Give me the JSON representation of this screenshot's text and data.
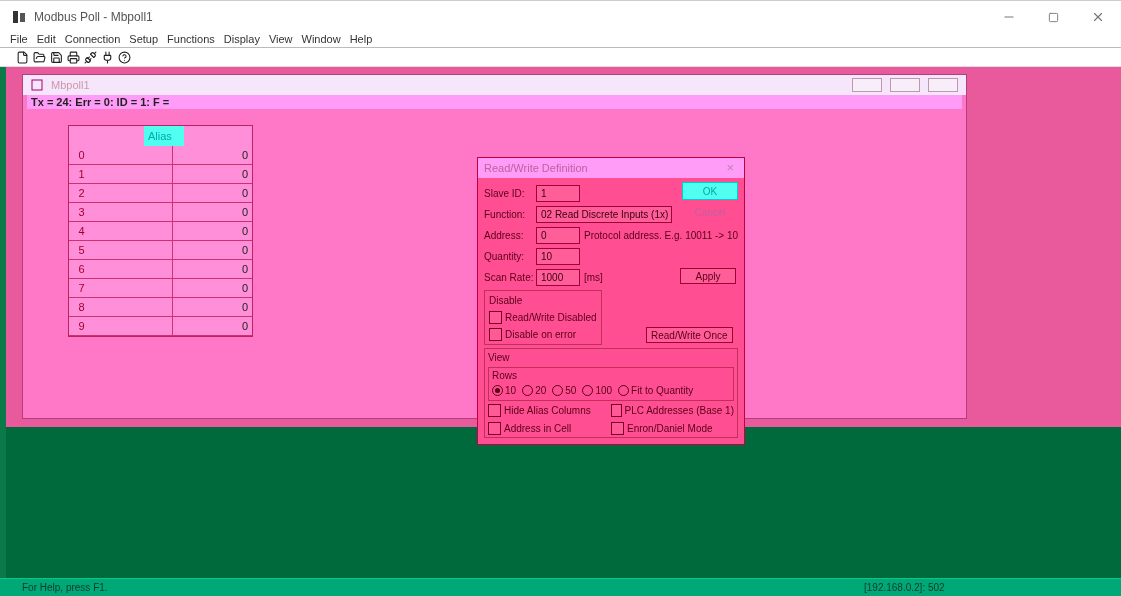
{
  "window": {
    "title": "Modbus Poll - Mbpoll1"
  },
  "menu": [
    "File",
    "Edit",
    "Connection",
    "Setup",
    "Functions",
    "Display",
    "View",
    "Window",
    "Help"
  ],
  "child": {
    "title": "Mbpoll1",
    "status_line": "Tx = 24: Err = 0: ID = 1: F =",
    "grid": {
      "header": "Alias",
      "rows": [
        {
          "index": "0",
          "value": "0"
        },
        {
          "index": "1",
          "value": "0"
        },
        {
          "index": "2",
          "value": "0"
        },
        {
          "index": "3",
          "value": "0"
        },
        {
          "index": "4",
          "value": "0"
        },
        {
          "index": "5",
          "value": "0"
        },
        {
          "index": "6",
          "value": "0"
        },
        {
          "index": "7",
          "value": "0"
        },
        {
          "index": "8",
          "value": "0"
        },
        {
          "index": "9",
          "value": "0"
        }
      ]
    }
  },
  "dialog": {
    "title": "Read/Write Definition",
    "close": "×",
    "slave_id": {
      "label": "Slave ID:",
      "value": "1"
    },
    "function": {
      "label": "Function:",
      "value": "02 Read Discrete Inputs (1x)"
    },
    "address": {
      "label": "Address:",
      "value": "0",
      "hint": "Protocol address. E.g. 10011 -> 10"
    },
    "quantity": {
      "label": "Quantity:",
      "value": "10"
    },
    "scan_rate": {
      "label": "Scan Rate:",
      "value": "1000",
      "unit": "[ms]"
    },
    "buttons": {
      "ok": "OK",
      "cancel": "Cancel",
      "apply": "Apply",
      "once": "Read/Write Once"
    },
    "disable": {
      "title": "Disable",
      "options": [
        {
          "label": "Read/Write Disabled",
          "checked": false
        },
        {
          "label": "Disable on error",
          "checked": false
        }
      ]
    },
    "view": {
      "title": "View",
      "rows_title": "Rows",
      "rows": [
        {
          "label": "10",
          "selected": true
        },
        {
          "label": "20",
          "selected": false
        },
        {
          "label": "50",
          "selected": false
        },
        {
          "label": "100",
          "selected": false
        },
        {
          "label": "Fit to Quantity",
          "selected": false
        }
      ],
      "options": [
        {
          "label": "Hide Alias Columns",
          "checked": false
        },
        {
          "label": "PLC Addresses (Base 1)",
          "checked": false
        },
        {
          "label": "Address in Cell",
          "checked": false
        },
        {
          "label": "Enron/Daniel Mode",
          "checked": false
        }
      ]
    }
  },
  "status_bar": {
    "help": "For Help, press F1.",
    "connection": "[192.168.0.2]: 502"
  }
}
